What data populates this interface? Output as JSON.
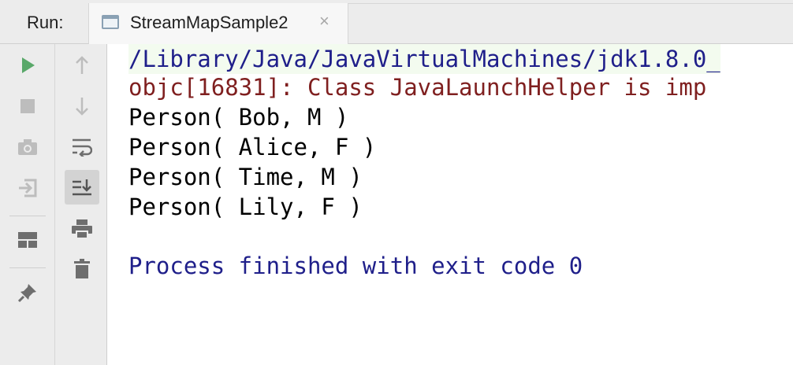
{
  "run_panel": {
    "label": "Run:",
    "tab": {
      "title": "StreamMapSample2",
      "close_glyph": "×"
    }
  },
  "toolbar_left": [
    {
      "name": "rerun-icon",
      "color": "#59a869"
    },
    {
      "name": "stop-icon"
    },
    {
      "name": "camera-icon"
    },
    {
      "name": "exit-icon"
    },
    {
      "name": "layout-icon"
    },
    {
      "name": "pin-icon"
    }
  ],
  "toolbar_right": [
    {
      "name": "up-arrow-icon"
    },
    {
      "name": "down-arrow-icon"
    },
    {
      "name": "soft-wrap-icon"
    },
    {
      "name": "scroll-to-end-icon",
      "active": true
    },
    {
      "name": "print-icon"
    },
    {
      "name": "trash-icon"
    }
  ],
  "console": {
    "lines": [
      {
        "kind": "cmd",
        "text": "/Library/Java/JavaVirtualMachines/jdk1.8.0_"
      },
      {
        "kind": "err",
        "text": "objc[16831]: Class JavaLaunchHelper is imp"
      },
      {
        "kind": "out",
        "text": "Person( Bob, M )"
      },
      {
        "kind": "out",
        "text": "Person( Alice, F )"
      },
      {
        "kind": "out",
        "text": "Person( Time, M )"
      },
      {
        "kind": "out",
        "text": "Person( Lily, F )"
      },
      {
        "kind": "out",
        "text": ""
      },
      {
        "kind": "exit",
        "text": "Process finished with exit code 0"
      }
    ]
  },
  "colors": {
    "stdout": "#000000",
    "stderr": "#7f1f1f",
    "system": "#1f1f8a",
    "run_green": "#59a869"
  }
}
